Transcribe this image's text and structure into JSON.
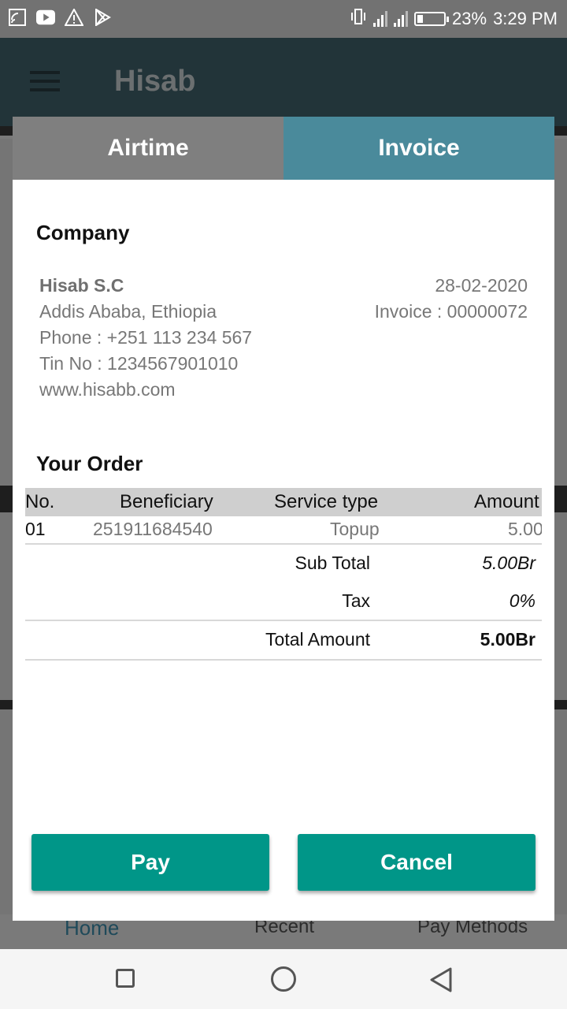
{
  "status_bar": {
    "battery_percent": "23%",
    "time": "3:29 PM",
    "battery_level": 0.23,
    "left_icons": [
      "cast-icon",
      "youtube-icon",
      "warning-icon",
      "play-store-icon"
    ],
    "right_icons": [
      "vibrate-icon",
      "signal-icon",
      "signal-icon",
      "battery-icon"
    ]
  },
  "app_bar": {
    "title": "Hisab"
  },
  "bottom_nav": {
    "items": [
      "Home",
      "Recent",
      "Pay Methods"
    ]
  },
  "dialog": {
    "tabs": [
      {
        "label": "Airtime",
        "selected": false
      },
      {
        "label": "Invoice",
        "selected": true
      }
    ],
    "company_heading": "Company",
    "company": {
      "name": "Hisab S.C",
      "address": "Addis Ababa, Ethiopia",
      "phone": "Phone : +251 113 234 567",
      "tin": "Tin No : 1234567901010",
      "website": "www.hisabb.com"
    },
    "invoice_date": "28-02-2020",
    "invoice_number": "Invoice : 00000072",
    "order_heading": "Your Order",
    "table": {
      "headers": [
        "No.",
        "Beneficiary",
        "Service type",
        "Amount"
      ],
      "rows": [
        [
          "01",
          "251911684540",
          "Topup",
          "5.00"
        ]
      ]
    },
    "summary": {
      "subtotal_label": "Sub Total",
      "subtotal_value": "5.00Br",
      "tax_label": "Tax",
      "tax_value": "0%",
      "total_label": "Total Amount",
      "total_value": "5.00Br"
    },
    "pay_label": "Pay",
    "cancel_label": "Cancel"
  },
  "colors": {
    "accent": "#009688",
    "tab_selected": "#4a8a9b",
    "tab_unselected": "#7f7f7f"
  }
}
